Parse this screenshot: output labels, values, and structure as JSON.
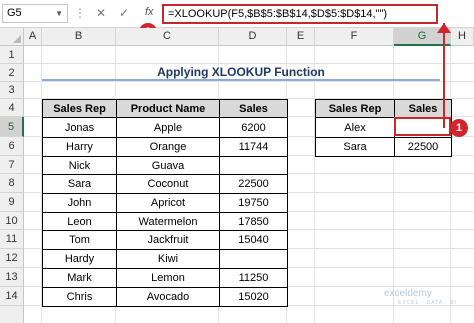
{
  "formula_bar": {
    "name_box": "G5",
    "cancel_icon": "✕",
    "enter_icon": "✓",
    "fx_label": "fx",
    "formula": "=XLOOKUP(F5,$B$5:$B$14,$D$5:$D$14,\"\")"
  },
  "markers": {
    "one": "1",
    "two": "2"
  },
  "columns": [
    "A",
    "B",
    "C",
    "D",
    "E",
    "F",
    "G",
    "H"
  ],
  "selected_column": "G",
  "rows": [
    "1",
    "2",
    "3",
    "4",
    "5",
    "6",
    "7",
    "8",
    "9",
    "10",
    "11",
    "12",
    "13",
    "14"
  ],
  "selected_row": "5",
  "title": "Applying XLOOKUP Function",
  "main_table": {
    "headers": [
      "Sales Rep",
      "Product Name",
      "Sales"
    ],
    "rows": [
      [
        "Jonas",
        "Apple",
        "6200"
      ],
      [
        "Harry",
        "Orange",
        "11744"
      ],
      [
        "Nick",
        "Guava",
        ""
      ],
      [
        "Sara",
        "Coconut",
        "22500"
      ],
      [
        "John",
        "Apricot",
        "19750"
      ],
      [
        "Leon",
        "Watermelon",
        "17850"
      ],
      [
        "Tom",
        "Jackfruit",
        "15040"
      ],
      [
        "Hardy",
        "Kiwi",
        ""
      ],
      [
        "Mark",
        "Lemon",
        "11250"
      ],
      [
        "Chris",
        "Avocado",
        "15020"
      ]
    ]
  },
  "lookup_table": {
    "headers": [
      "Sales Rep",
      "Sales"
    ],
    "rows": [
      [
        "Alex",
        ""
      ],
      [
        "Sara",
        "22500"
      ]
    ]
  },
  "watermark": {
    "brand": "exceldemy",
    "tagline": "EXCEL · DATA · BI"
  },
  "accent_color": "#d0252b"
}
